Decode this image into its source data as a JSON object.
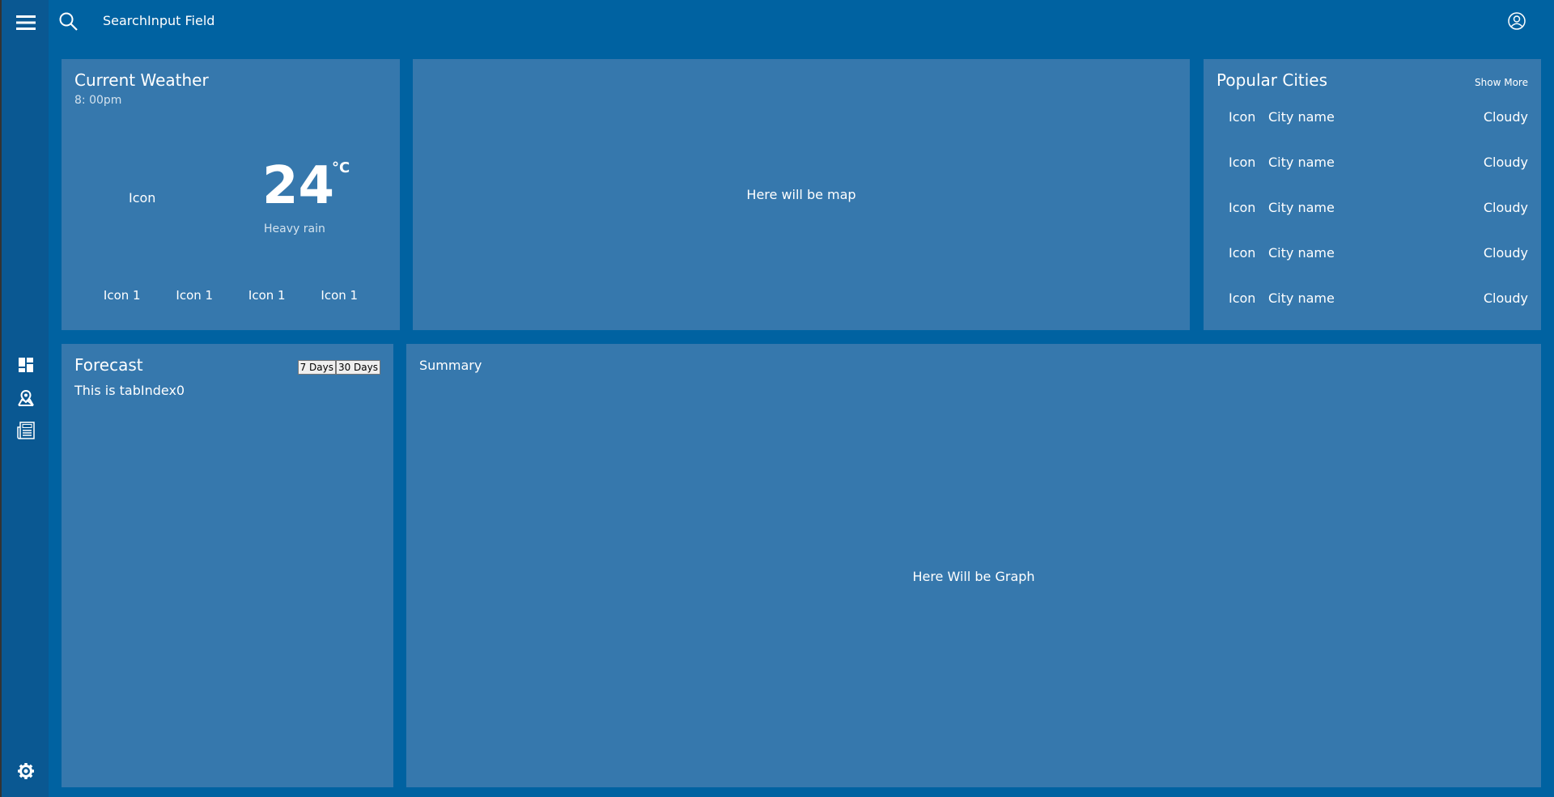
{
  "nav": {
    "icons": [
      "hamburger-menu-icon",
      "dashboard-icon",
      "map-icon",
      "news-icon",
      "settings-icon"
    ]
  },
  "header": {
    "search_value": "SearchInput Field",
    "search_icon": "search-icon",
    "user_icon": "user-account-icon"
  },
  "current_weather": {
    "title": "Current Weather",
    "time": "8: 00pm",
    "icon_label": "Icon",
    "temperature": "24",
    "unit": "°C",
    "description": "Heavy rain",
    "extra_icons": [
      "Icon 1",
      "Icon 1",
      "Icon 1",
      "Icon 1"
    ]
  },
  "map": {
    "placeholder": "Here will be map"
  },
  "popular_cities": {
    "title": "Popular Cities",
    "show_more": "Show More",
    "cities": [
      {
        "icon": "Icon",
        "name": "City name",
        "condition": "Cloudy"
      },
      {
        "icon": "Icon",
        "name": "City name",
        "condition": "Cloudy"
      },
      {
        "icon": "Icon",
        "name": "City name",
        "condition": "Cloudy"
      },
      {
        "icon": "Icon",
        "name": "City name",
        "condition": "Cloudy"
      },
      {
        "icon": "Icon",
        "name": "City name",
        "condition": "Cloudy"
      }
    ]
  },
  "forecast": {
    "title": "Forecast",
    "tabs": [
      "7 Days",
      "30 Days"
    ],
    "content": "This is tabIndex0"
  },
  "summary": {
    "title": "Summary",
    "placeholder": "Here Will be Graph"
  }
}
